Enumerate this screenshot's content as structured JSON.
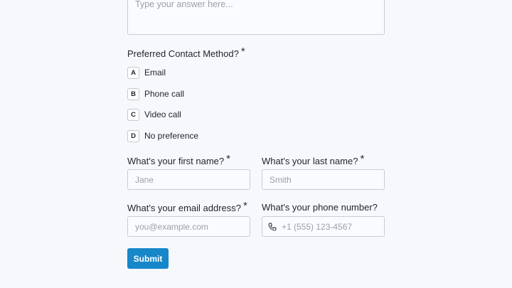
{
  "answer_textarea": {
    "placeholder": "Type your answer here..."
  },
  "contact_method": {
    "label": "Preferred Contact Method?",
    "required_mark": "*",
    "options": [
      {
        "key": "A",
        "label": "Email"
      },
      {
        "key": "B",
        "label": "Phone call"
      },
      {
        "key": "C",
        "label": "Video call"
      },
      {
        "key": "D",
        "label": "No preference"
      }
    ]
  },
  "first_name": {
    "label": "What's your first name?",
    "required_mark": "*",
    "placeholder": "Jane"
  },
  "last_name": {
    "label": "What's your last name?",
    "required_mark": "*",
    "placeholder": "Smith"
  },
  "email": {
    "label": "What's your email address?",
    "required_mark": "*",
    "placeholder": "you@example.com"
  },
  "phone": {
    "label": "What's your phone number?",
    "placeholder": "+1 (555) 123-4567",
    "icon": "phone-icon"
  },
  "submit": {
    "label": "Submit",
    "color": "#1887c9"
  }
}
